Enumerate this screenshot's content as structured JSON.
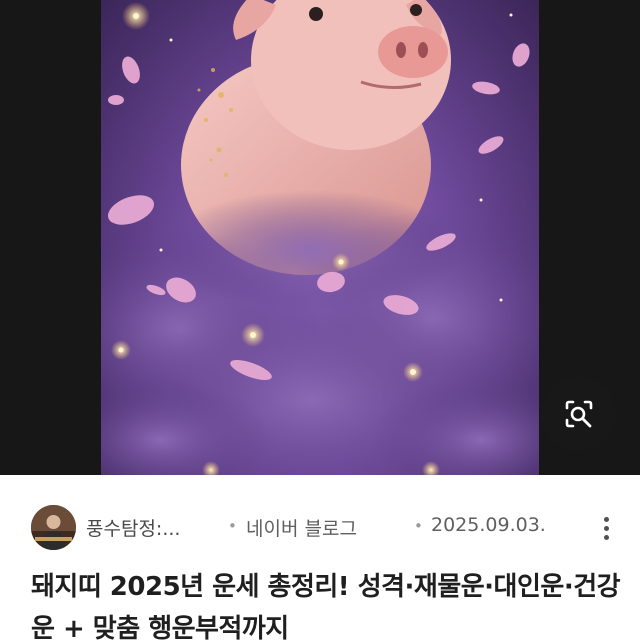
{
  "image": {
    "alt": "돼지띠 2025년 운세 총정리! 성격·재물운·대인운·건강운 + 맞춤 행운부적까지",
    "icon": "pig-image"
  },
  "lens": {
    "icon": "image-search-icon"
  },
  "result": {
    "author": "풍수탐정:...",
    "separator": "•",
    "source": "네이버 블로그",
    "date": "2025.09.03.",
    "more_icon": "more-vertical-icon",
    "title": "돼지띠 2025년 운세 총정리! 성격·재물운·대인운·건강운 + 맞춤 행운부적까지"
  },
  "colors": {
    "background": "#ffffff",
    "image_backdrop": "#171717",
    "title_text": "#1f1f1f",
    "meta_text": "#5f5f5f"
  }
}
